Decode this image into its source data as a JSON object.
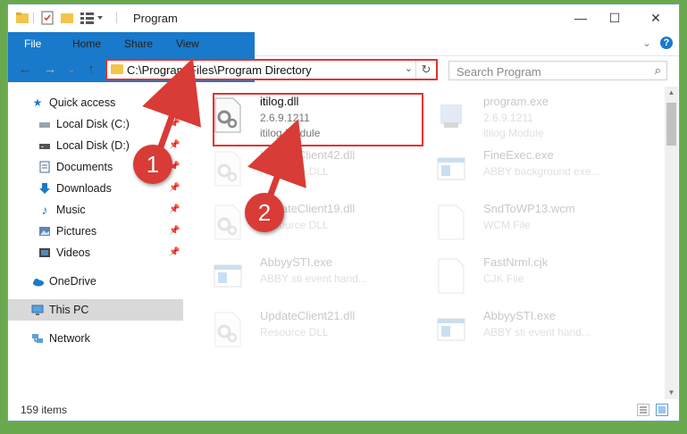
{
  "window": {
    "title": "Program",
    "controls": {
      "minimize": "—",
      "maximize": "☐",
      "close": "✕"
    }
  },
  "ribbon": {
    "tabs": [
      "File",
      "Home",
      "Share",
      "View"
    ],
    "help": "?"
  },
  "nav": {
    "back": "←",
    "forward": "→",
    "recent": "⌄",
    "up": "↑",
    "address": "C:\\Program Files\\Program Directory",
    "dropdown": "⌄",
    "refresh": "↻",
    "search_placeholder": "Search Program",
    "search_icon": "magnifier-icon"
  },
  "sidebar": {
    "items": [
      {
        "label": "Quick access",
        "icon": "star-icon",
        "pinned": false
      },
      {
        "label": "Local Disk (C:)",
        "icon": "drive-icon",
        "pinned": true
      },
      {
        "label": "Local Disk (D:)",
        "icon": "drive-icon",
        "pinned": true
      },
      {
        "label": "Documents",
        "icon": "documents-icon",
        "pinned": true
      },
      {
        "label": "Downloads",
        "icon": "download-icon",
        "pinned": true
      },
      {
        "label": "Music",
        "icon": "music-icon",
        "pinned": true
      },
      {
        "label": "Pictures",
        "icon": "pictures-icon",
        "pinned": true
      },
      {
        "label": "Videos",
        "icon": "videos-icon",
        "pinned": true
      },
      {
        "label": "OneDrive",
        "icon": "cloud-icon",
        "pinned": false
      },
      {
        "label": "This PC",
        "icon": "computer-icon",
        "pinned": false,
        "selected": true
      },
      {
        "label": "Network",
        "icon": "network-icon",
        "pinned": false
      }
    ]
  },
  "files": [
    {
      "name": "itilog.dll",
      "line2": "2.6.9.1211",
      "line3": "itilog Module",
      "icon": "dll-gear-icon",
      "highlighted": true
    },
    {
      "name": "program.exe",
      "line2": "2.6.9.1211",
      "line3": "itilog Module",
      "icon": "exe-icon"
    },
    {
      "name": "UpdateClient42.dll",
      "line2": "Resource DLL",
      "line3": "",
      "icon": "dll-gear-icon"
    },
    {
      "name": "FineExec.exe",
      "line2": "ABBY background exe...",
      "line3": "",
      "icon": "app-window-icon"
    },
    {
      "name": "UpdateClient19.dll",
      "line2": "Resource DLL",
      "line3": "",
      "icon": "dll-gear-icon"
    },
    {
      "name": "SndToWP13.wcm",
      "line2": "WCM File",
      "line3": "",
      "icon": "blank-file-icon"
    },
    {
      "name": "AbbyySTI.exe",
      "line2": "ABBY sti event hand...",
      "line3": "",
      "icon": "app-window-icon"
    },
    {
      "name": "FastNrml.cjk",
      "line2": "CJK File",
      "line3": "",
      "icon": "blank-file-icon"
    },
    {
      "name": "UpdateClient21.dll",
      "line2": "Resource DLL",
      "line3": "",
      "icon": "dll-gear-icon"
    },
    {
      "name": "AbbyySTI.exe",
      "line2": "ABBY sti event hand...",
      "line3": "",
      "icon": "app-window-icon"
    }
  ],
  "status": {
    "count": "159 items"
  },
  "callouts": [
    "1",
    "2"
  ],
  "colors": {
    "accent": "#1979ca",
    "highlight": "#e2332f",
    "callout": "#d93b36",
    "folder": "#f3c54b"
  }
}
